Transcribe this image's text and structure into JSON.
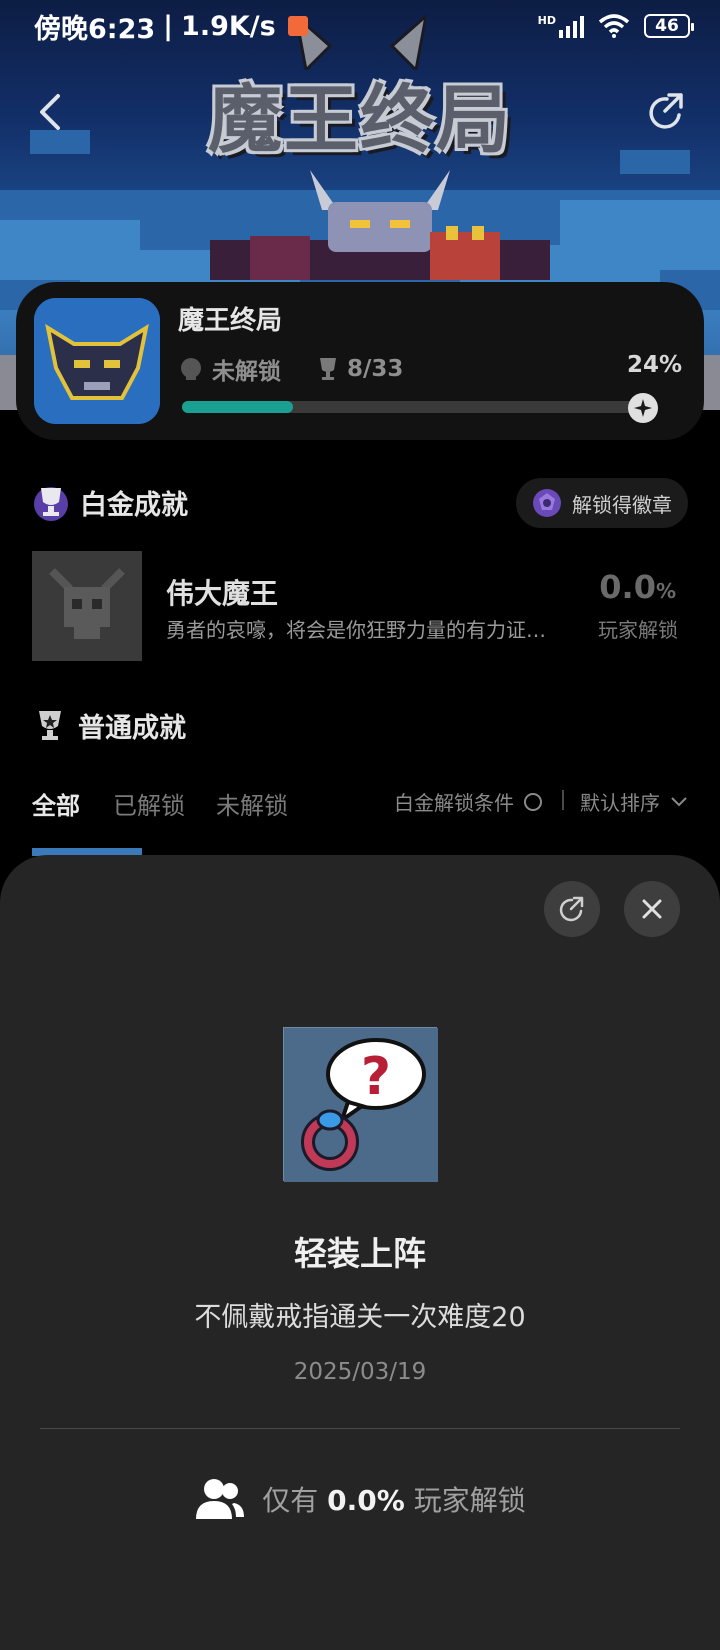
{
  "status_bar": {
    "time": "傍晚6:23",
    "separator": "|",
    "speed": "1.9K/s",
    "network": "HD",
    "battery": "46"
  },
  "banner": {
    "title": "魔王终局"
  },
  "game": {
    "title": "魔王终局",
    "lock_status": "未解锁",
    "trophy_count": "8/33",
    "percent": "24%",
    "progress": 0.24
  },
  "platinum": {
    "section_title": "白金成就",
    "badge_button": "解锁得徽章",
    "item": {
      "title": "伟大魔王",
      "description": "勇者的哀嚎，将会是你狂野力量的有力证…",
      "rate": "0.0",
      "rate_unit": "%",
      "rate_label": "玩家解锁"
    }
  },
  "normal": {
    "section_title": "普通成就",
    "tabs": [
      "全部",
      "已解锁",
      "未解锁"
    ],
    "filter_label": "白金解锁条件",
    "sort_label": "默认排序"
  },
  "sheet": {
    "achievement_title": "轻装上阵",
    "achievement_desc": "不佩戴戒指通关一次难度20",
    "date": "2025/03/19",
    "rate_prefix": "仅有",
    "rate_value": "0.0%",
    "rate_suffix": "玩家解锁"
  },
  "colors": {
    "accent": "#1aa093",
    "background": "#000000",
    "sheet": "#252525"
  }
}
